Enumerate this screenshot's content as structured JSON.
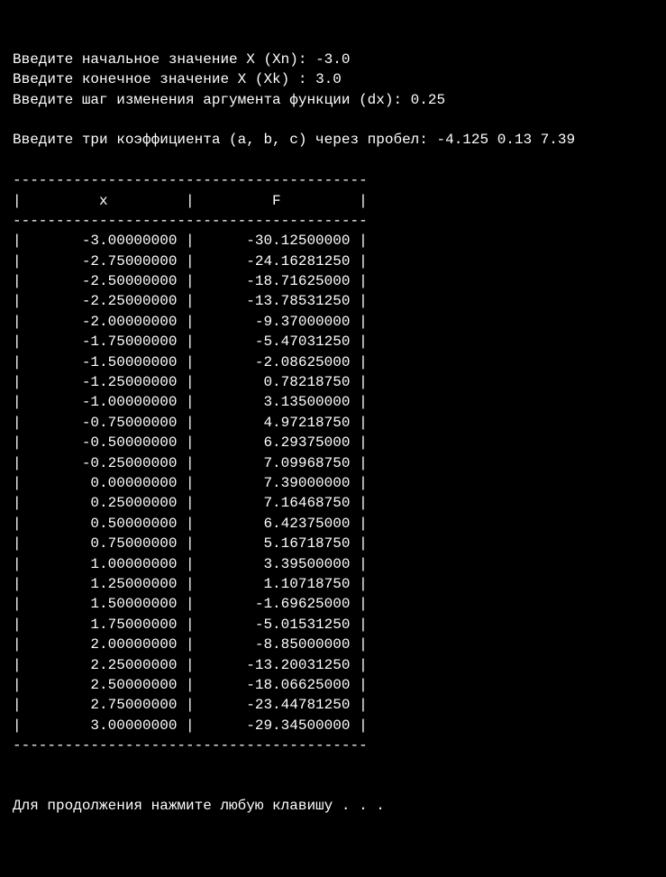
{
  "prompts": {
    "xn_label": "Введите начальное значение X (Xn): ",
    "xn_value": "-3.0",
    "xk_label": "Введите конечное значение X (Xk) : ",
    "xk_value": "3.0",
    "dx_label": "Введите шаг изменения аргумента функции (dx): ",
    "dx_value": "0.25",
    "coef_label": "Введите три коэффициента (a, b, c) через пробел: ",
    "coef_value": "-4.125 0.13 7.39"
  },
  "table": {
    "divider": "-----------------------------------------",
    "header": "|         x         |         F         |",
    "rows": [
      {
        "x": "       -3.00000000",
        "f": "      -30.12500000"
      },
      {
        "x": "       -2.75000000",
        "f": "      -24.16281250"
      },
      {
        "x": "       -2.50000000",
        "f": "      -18.71625000"
      },
      {
        "x": "       -2.25000000",
        "f": "      -13.78531250"
      },
      {
        "x": "       -2.00000000",
        "f": "       -9.37000000"
      },
      {
        "x": "       -1.75000000",
        "f": "       -5.47031250"
      },
      {
        "x": "       -1.50000000",
        "f": "       -2.08625000"
      },
      {
        "x": "       -1.25000000",
        "f": "        0.78218750"
      },
      {
        "x": "       -1.00000000",
        "f": "        3.13500000"
      },
      {
        "x": "       -0.75000000",
        "f": "        4.97218750"
      },
      {
        "x": "       -0.50000000",
        "f": "        6.29375000"
      },
      {
        "x": "       -0.25000000",
        "f": "        7.09968750"
      },
      {
        "x": "        0.00000000",
        "f": "        7.39000000"
      },
      {
        "x": "        0.25000000",
        "f": "        7.16468750"
      },
      {
        "x": "        0.50000000",
        "f": "        6.42375000"
      },
      {
        "x": "        0.75000000",
        "f": "        5.16718750"
      },
      {
        "x": "        1.00000000",
        "f": "        3.39500000"
      },
      {
        "x": "        1.25000000",
        "f": "        1.10718750"
      },
      {
        "x": "        1.50000000",
        "f": "       -1.69625000"
      },
      {
        "x": "        1.75000000",
        "f": "       -5.01531250"
      },
      {
        "x": "        2.00000000",
        "f": "       -8.85000000"
      },
      {
        "x": "        2.25000000",
        "f": "      -13.20031250"
      },
      {
        "x": "        2.50000000",
        "f": "      -18.06625000"
      },
      {
        "x": "        2.75000000",
        "f": "      -23.44781250"
      },
      {
        "x": "        3.00000000",
        "f": "      -29.34500000"
      }
    ]
  },
  "footer": {
    "continue_prompt": "Для продолжения нажмите любую клавишу . . ."
  }
}
